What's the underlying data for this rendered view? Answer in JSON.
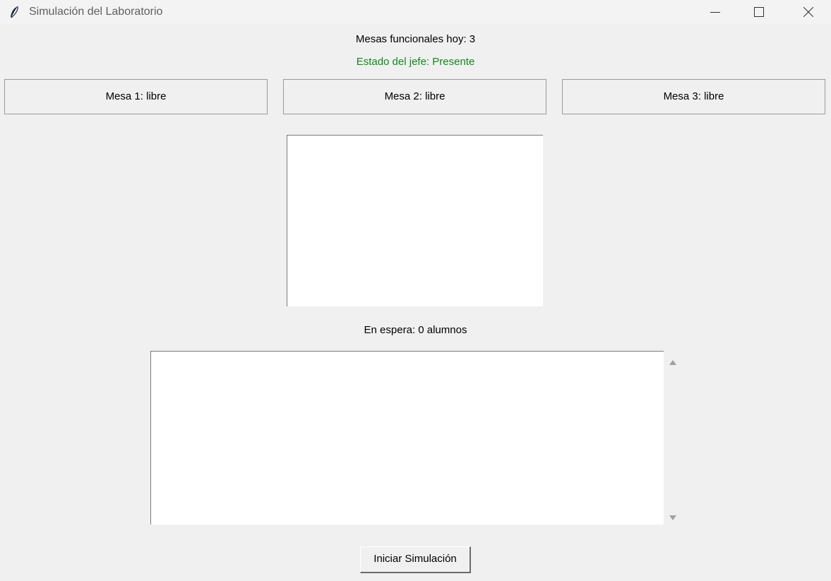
{
  "window": {
    "title": "Simulación del Laboratorio",
    "icon": "feather-icon"
  },
  "status": {
    "mesas_funcionales": "Mesas funcionales hoy: 3",
    "estado_jefe": "Estado del jefe: Presente",
    "estado_jefe_color": "#11891b",
    "en_espera": "En espera: 0 alumnos"
  },
  "mesas": [
    {
      "label": "Mesa 1: libre"
    },
    {
      "label": "Mesa 2: libre"
    },
    {
      "label": "Mesa 3: libre"
    }
  ],
  "log": {
    "content": ""
  },
  "actions": {
    "start_label": "Iniciar Simulación"
  }
}
